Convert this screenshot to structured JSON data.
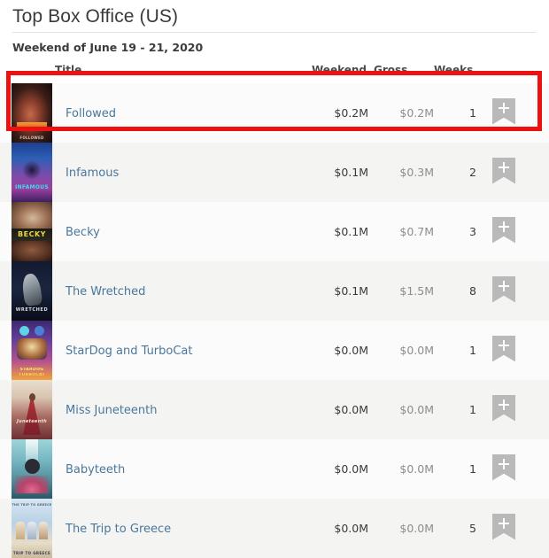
{
  "header": {
    "title": "Top Box Office (US)",
    "subtitle": "Weekend of June 19 - 21, 2020"
  },
  "table": {
    "columns": {
      "title": "Title",
      "weekend": "Weekend",
      "gross": "Gross",
      "weeks": "Weeks"
    },
    "rows": [
      {
        "title": "Followed",
        "weekend": "$0.2M",
        "gross": "$0.2M",
        "weeks": "1",
        "poster_alt": "Followed poster",
        "poster_text": "FOLLOWED",
        "action_label": "+"
      },
      {
        "title": "Infamous",
        "weekend": "$0.1M",
        "gross": "$0.3M",
        "weeks": "2",
        "poster_alt": "Infamous poster",
        "poster_text": "INFAMOUS",
        "action_label": "+"
      },
      {
        "title": "Becky",
        "weekend": "$0.1M",
        "gross": "$0.7M",
        "weeks": "3",
        "poster_alt": "Becky poster",
        "poster_text": "BECKY",
        "action_label": "+"
      },
      {
        "title": "The Wretched",
        "weekend": "$0.1M",
        "gross": "$1.5M",
        "weeks": "8",
        "poster_alt": "The Wretched poster",
        "poster_text": "WRETCHED",
        "action_label": "+"
      },
      {
        "title": "StarDog and TurboCat",
        "weekend": "$0.0M",
        "gross": "$0.0M",
        "weeks": "1",
        "poster_alt": "StarDog and TurboCat poster",
        "poster_text": "STARDOG",
        "poster_text2": "TURBOCAT",
        "action_label": "+"
      },
      {
        "title": "Miss Juneteenth",
        "weekend": "$0.0M",
        "gross": "$0.0M",
        "weeks": "1",
        "poster_alt": "Miss Juneteenth poster",
        "poster_text": "Juneteenth",
        "action_label": "+"
      },
      {
        "title": "Babyteeth",
        "weekend": "$0.0M",
        "gross": "$0.0M",
        "weeks": "1",
        "poster_alt": "Babyteeth poster",
        "poster_text": "",
        "action_label": "+"
      },
      {
        "title": "The Trip to Greece",
        "weekend": "$0.0M",
        "gross": "$0.0M",
        "weeks": "5",
        "poster_alt": "The Trip to Greece poster",
        "poster_text": "TRIP TO GREECE",
        "poster_text2": "THE TRIP TO GREECE",
        "action_label": "+"
      }
    ]
  },
  "annotation": {
    "highlight_color": "#ee1111",
    "highlighted_row_index": 0
  },
  "colors": {
    "link": "#49779c",
    "heading": "#3a3a3a",
    "gross_text": "#8d8d8d",
    "row_odd_bg": "#fbfbfc",
    "row_even_bg": "#f4f4f3",
    "bookmark": "#b9b9b9"
  }
}
